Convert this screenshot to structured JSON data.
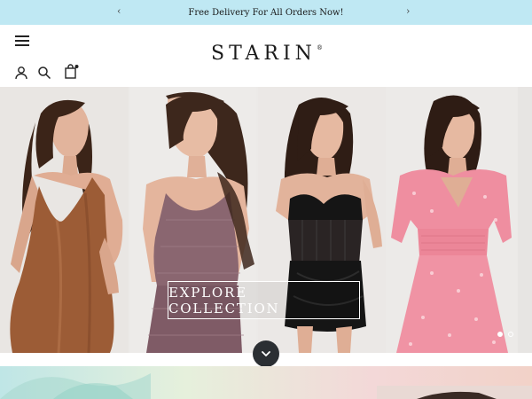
{
  "announcement": {
    "text": "Free Delivery For All Orders Now!",
    "prev_icon": "chevron-left-icon",
    "next_icon": "chevron-right-icon"
  },
  "header": {
    "menu_icon": "hamburger-menu-icon",
    "logo_text": "STARIN",
    "logo_mark": "®",
    "icons": [
      "account-icon",
      "search-icon",
      "shopping-bag-icon"
    ]
  },
  "hero": {
    "cta_label": "EXPLORE COLLECTION",
    "slide_dots": 2,
    "active_dot": 1,
    "scroll_icon": "chevron-down-icon",
    "dresses": [
      {
        "name": "brown satin slip dress",
        "color": "#9c5c36"
      },
      {
        "name": "mauve sequin cami set",
        "color": "#8a6670"
      },
      {
        "name": "black corset mini dress",
        "color": "#151515"
      },
      {
        "name": "pink floral puff-sleeve dress",
        "color": "#ef8ea0"
      }
    ]
  },
  "colors": {
    "announcement_bg": "#bfe8f3",
    "scroll_button_bg": "#2b2f33"
  }
}
